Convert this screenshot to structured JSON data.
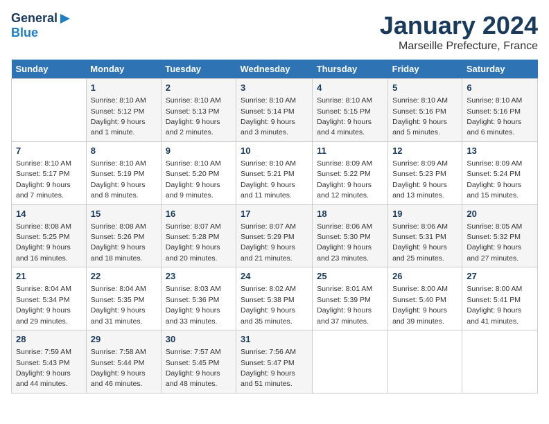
{
  "header": {
    "logo_line1": "General",
    "logo_line2": "Blue",
    "month": "January 2024",
    "location": "Marseille Prefecture, France"
  },
  "days_of_week": [
    "Sunday",
    "Monday",
    "Tuesday",
    "Wednesday",
    "Thursday",
    "Friday",
    "Saturday"
  ],
  "weeks": [
    [
      {
        "day": "",
        "info": ""
      },
      {
        "day": "1",
        "info": "Sunrise: 8:10 AM\nSunset: 5:12 PM\nDaylight: 9 hours\nand 1 minute."
      },
      {
        "day": "2",
        "info": "Sunrise: 8:10 AM\nSunset: 5:13 PM\nDaylight: 9 hours\nand 2 minutes."
      },
      {
        "day": "3",
        "info": "Sunrise: 8:10 AM\nSunset: 5:14 PM\nDaylight: 9 hours\nand 3 minutes."
      },
      {
        "day": "4",
        "info": "Sunrise: 8:10 AM\nSunset: 5:15 PM\nDaylight: 9 hours\nand 4 minutes."
      },
      {
        "day": "5",
        "info": "Sunrise: 8:10 AM\nSunset: 5:16 PM\nDaylight: 9 hours\nand 5 minutes."
      },
      {
        "day": "6",
        "info": "Sunrise: 8:10 AM\nSunset: 5:16 PM\nDaylight: 9 hours\nand 6 minutes."
      }
    ],
    [
      {
        "day": "7",
        "info": "Sunrise: 8:10 AM\nSunset: 5:17 PM\nDaylight: 9 hours\nand 7 minutes."
      },
      {
        "day": "8",
        "info": "Sunrise: 8:10 AM\nSunset: 5:19 PM\nDaylight: 9 hours\nand 8 minutes."
      },
      {
        "day": "9",
        "info": "Sunrise: 8:10 AM\nSunset: 5:20 PM\nDaylight: 9 hours\nand 9 minutes."
      },
      {
        "day": "10",
        "info": "Sunrise: 8:10 AM\nSunset: 5:21 PM\nDaylight: 9 hours\nand 11 minutes."
      },
      {
        "day": "11",
        "info": "Sunrise: 8:09 AM\nSunset: 5:22 PM\nDaylight: 9 hours\nand 12 minutes."
      },
      {
        "day": "12",
        "info": "Sunrise: 8:09 AM\nSunset: 5:23 PM\nDaylight: 9 hours\nand 13 minutes."
      },
      {
        "day": "13",
        "info": "Sunrise: 8:09 AM\nSunset: 5:24 PM\nDaylight: 9 hours\nand 15 minutes."
      }
    ],
    [
      {
        "day": "14",
        "info": "Sunrise: 8:08 AM\nSunset: 5:25 PM\nDaylight: 9 hours\nand 16 minutes."
      },
      {
        "day": "15",
        "info": "Sunrise: 8:08 AM\nSunset: 5:26 PM\nDaylight: 9 hours\nand 18 minutes."
      },
      {
        "day": "16",
        "info": "Sunrise: 8:07 AM\nSunset: 5:28 PM\nDaylight: 9 hours\nand 20 minutes."
      },
      {
        "day": "17",
        "info": "Sunrise: 8:07 AM\nSunset: 5:29 PM\nDaylight: 9 hours\nand 21 minutes."
      },
      {
        "day": "18",
        "info": "Sunrise: 8:06 AM\nSunset: 5:30 PM\nDaylight: 9 hours\nand 23 minutes."
      },
      {
        "day": "19",
        "info": "Sunrise: 8:06 AM\nSunset: 5:31 PM\nDaylight: 9 hours\nand 25 minutes."
      },
      {
        "day": "20",
        "info": "Sunrise: 8:05 AM\nSunset: 5:32 PM\nDaylight: 9 hours\nand 27 minutes."
      }
    ],
    [
      {
        "day": "21",
        "info": "Sunrise: 8:04 AM\nSunset: 5:34 PM\nDaylight: 9 hours\nand 29 minutes."
      },
      {
        "day": "22",
        "info": "Sunrise: 8:04 AM\nSunset: 5:35 PM\nDaylight: 9 hours\nand 31 minutes."
      },
      {
        "day": "23",
        "info": "Sunrise: 8:03 AM\nSunset: 5:36 PM\nDaylight: 9 hours\nand 33 minutes."
      },
      {
        "day": "24",
        "info": "Sunrise: 8:02 AM\nSunset: 5:38 PM\nDaylight: 9 hours\nand 35 minutes."
      },
      {
        "day": "25",
        "info": "Sunrise: 8:01 AM\nSunset: 5:39 PM\nDaylight: 9 hours\nand 37 minutes."
      },
      {
        "day": "26",
        "info": "Sunrise: 8:00 AM\nSunset: 5:40 PM\nDaylight: 9 hours\nand 39 minutes."
      },
      {
        "day": "27",
        "info": "Sunrise: 8:00 AM\nSunset: 5:41 PM\nDaylight: 9 hours\nand 41 minutes."
      }
    ],
    [
      {
        "day": "28",
        "info": "Sunrise: 7:59 AM\nSunset: 5:43 PM\nDaylight: 9 hours\nand 44 minutes."
      },
      {
        "day": "29",
        "info": "Sunrise: 7:58 AM\nSunset: 5:44 PM\nDaylight: 9 hours\nand 46 minutes."
      },
      {
        "day": "30",
        "info": "Sunrise: 7:57 AM\nSunset: 5:45 PM\nDaylight: 9 hours\nand 48 minutes."
      },
      {
        "day": "31",
        "info": "Sunrise: 7:56 AM\nSunset: 5:47 PM\nDaylight: 9 hours\nand 51 minutes."
      },
      {
        "day": "",
        "info": ""
      },
      {
        "day": "",
        "info": ""
      },
      {
        "day": "",
        "info": ""
      }
    ]
  ]
}
